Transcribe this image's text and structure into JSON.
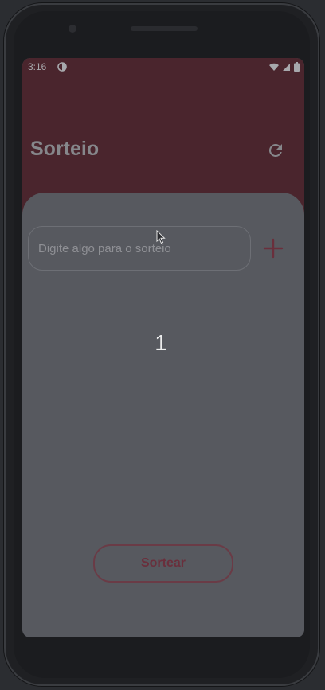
{
  "status_bar": {
    "time": "3:16",
    "icons": [
      "data-saver-icon",
      "wifi-icon",
      "signal-icon",
      "battery-icon"
    ]
  },
  "app_bar": {
    "title": "Sorteio",
    "actions": [
      "refresh-icon"
    ]
  },
  "main": {
    "input_placeholder": "Digite algo para o sorteio",
    "input_value": "",
    "add_icon": "plus-icon",
    "count": "1",
    "draw_button_label": "Sortear"
  },
  "colors": {
    "app_bar": "#4a252d",
    "accent": "#6a2f3c",
    "scrim": "#57595f"
  }
}
